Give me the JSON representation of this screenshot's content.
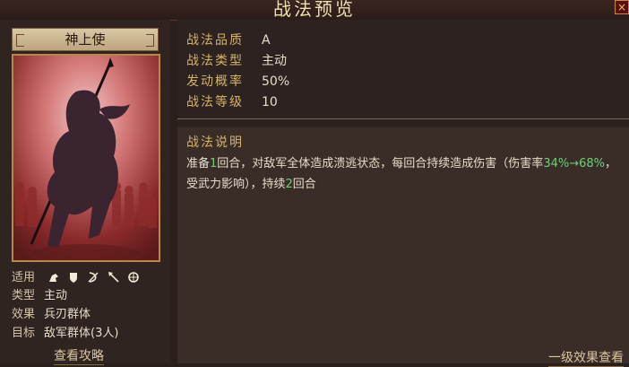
{
  "window": {
    "title": "战法预览",
    "close_label": "×"
  },
  "skill": {
    "name": "神上使",
    "properties": [
      {
        "label": "战法品质",
        "value": "A"
      },
      {
        "label": "战法类型",
        "value": "主动"
      },
      {
        "label": "发动概率",
        "value": "50%"
      },
      {
        "label": "战法等级",
        "value": "10"
      }
    ],
    "info": {
      "applicable_label": "适用",
      "applicable_icons": [
        "cavalry-icon",
        "shield-icon",
        "bow-icon",
        "spear-icon",
        "wheel-icon"
      ],
      "type_label": "类型",
      "type_value": "主动",
      "effect_label": "效果",
      "effect_value": "兵刃群体",
      "target_label": "目标",
      "target_value": "敌军群体(3人)"
    },
    "view_strategy_link": "查看攻略",
    "description_title": "战法说明",
    "description": {
      "p1": "准备",
      "n1": "1",
      "p2": "回合，对敌军全体造成溃逃状态，每回合持续造成伤害（伤害率",
      "pct": "34%→68%",
      "p3": "，受武力影响），持续",
      "n2": "2",
      "p4": "回合"
    },
    "level_effect_link": "一级效果查看"
  },
  "colors": {
    "accent_gold": "#d6b36a",
    "highlight_green": "#6ed07a"
  }
}
